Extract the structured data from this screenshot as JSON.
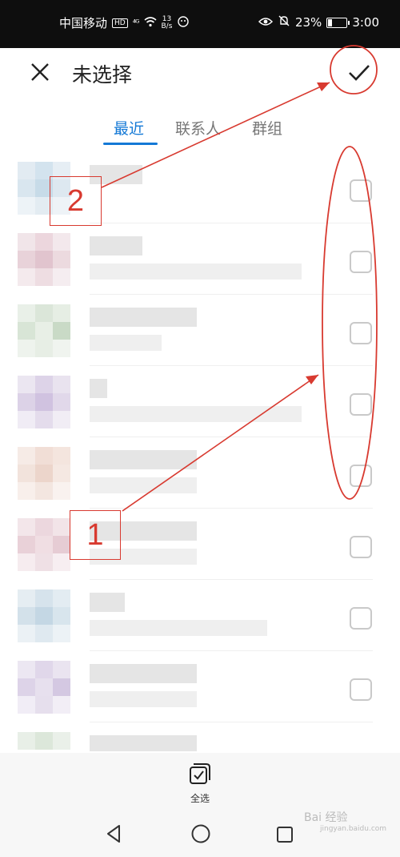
{
  "status_bar": {
    "carrier": "中国移动",
    "hd": "HD",
    "signal": "⁴ᴳ",
    "speed_value": "13",
    "speed_unit": "B/s",
    "battery": "23%",
    "time": "3:00"
  },
  "header": {
    "title": "未选择"
  },
  "tabs": [
    {
      "label": "最近",
      "active": true
    },
    {
      "label": "联系人",
      "active": false
    },
    {
      "label": "群组",
      "active": false
    }
  ],
  "contacts": [
    {
      "checked": false
    },
    {
      "checked": false
    },
    {
      "checked": false
    },
    {
      "checked": false
    },
    {
      "checked": false
    },
    {
      "checked": false
    },
    {
      "checked": false
    },
    {
      "checked": false
    }
  ],
  "bottom_bar": {
    "select_all_label": "全选"
  },
  "annotations": {
    "label_1": "1",
    "label_2": "2"
  },
  "watermark": {
    "main": "Bai 经验",
    "sub": "jingyan.baidu.com"
  },
  "colors": {
    "accent": "#1479d6",
    "annotation": "#d83a30"
  }
}
